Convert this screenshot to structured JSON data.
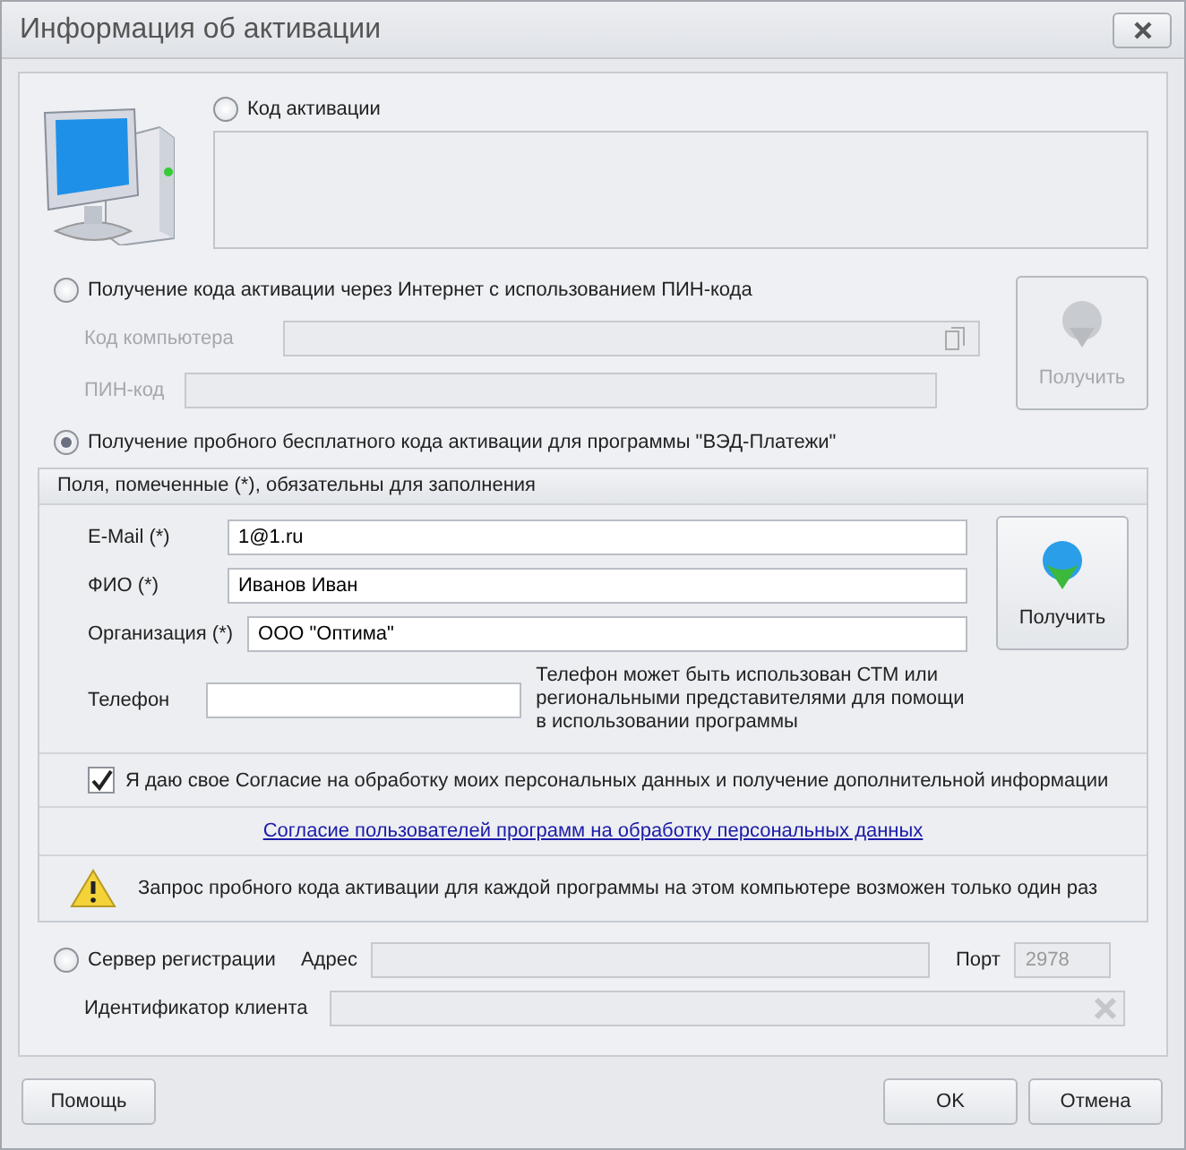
{
  "window": {
    "title": "Информация об активации"
  },
  "activation_code": {
    "label": "Код активации",
    "selected": false
  },
  "internet": {
    "label": "Получение кода активации через Интернет с использованием ПИН-кода",
    "selected": false,
    "fields": [
      {
        "label": "Код компьютера",
        "disabled": true
      },
      {
        "label": "ПИН-код",
        "disabled": true
      }
    ],
    "button": {
      "label": "Получить",
      "disabled": true
    }
  },
  "trial": {
    "label": "Получение пробного бесплатного кода активации для программы \"ВЭД-Платежи\"",
    "selected": true,
    "header": "Поля, помеченные (*), обязательны для заполнения",
    "fields": [
      {
        "label": "E-Mail (*)",
        "value": "1@1.ru"
      },
      {
        "label": "ФИО (*)",
        "value": "Иванов Иван"
      },
      {
        "label": "Организация (*)",
        "value": "ООО \"Оптима\""
      },
      {
        "label": "Телефон",
        "note": "Телефон может быть использован СТМ или региональными представителями для помощи в использовании программы"
      }
    ],
    "button": {
      "label": "Получить",
      "disabled": false
    },
    "consent": {
      "label": "Я даю свое Согласие на обработку моих персональных данных и получение дополнительной информации",
      "checked": true
    },
    "link": "Согласие пользователей программ на обработку персональных данных",
    "warning": "Запрос пробного кода активации для каждой программы на этом компьютере возможен только один раз"
  },
  "server": {
    "label": "Сервер регистрации",
    "selected": false,
    "address_label": "Адрес",
    "port_label": "Порт",
    "port_value": "2978",
    "client_id_label": "Идентификатор клиента"
  },
  "buttons": {
    "help": "Помощь",
    "ok": "OK",
    "cancel": "Отмена"
  }
}
